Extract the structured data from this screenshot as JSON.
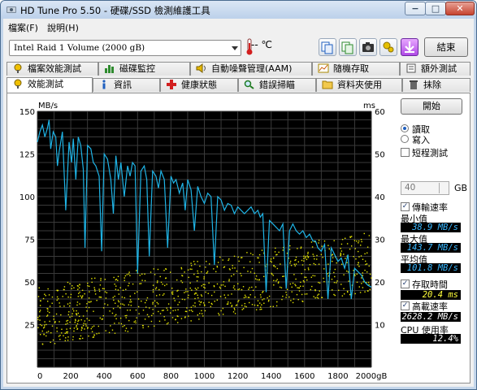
{
  "window": {
    "title": "HD Tune Pro 5.50 - 硬碟/SSD 檢測維護工具",
    "min_symbol": "−",
    "max_symbol": "□",
    "close_symbol": "✕"
  },
  "menu": {
    "file": "檔案(F)",
    "help": "說明(H)"
  },
  "toolbar": {
    "drive": "Intel  Raid 1 Volume (2000 gB)",
    "temperature": "-- ℃",
    "exit_label": "結束",
    "icons": [
      "copy-info-icon",
      "copy-screen-icon",
      "camera-icon",
      "settings-icon",
      "download-icon"
    ]
  },
  "tabs_row1": [
    "檔案效能測試",
    "磁碟監控",
    "自動噪聲管理(AAM)",
    "隨機存取",
    "額外測試"
  ],
  "tabs_row2": [
    "效能測試",
    "資訊",
    "健康狀態",
    "錯誤掃瞄",
    "資料夾使用",
    "抹除"
  ],
  "right_panel": {
    "start_label": "開始",
    "read_label": "讀取",
    "write_label": "寫入",
    "short_test_label": "短程測試",
    "short_test_value": "40",
    "short_test_unit": "GB",
    "transfer_rate_label": "傳輸速率",
    "min_label": "最小值",
    "min_value": "38.9 MB/s",
    "max_label": "最大值",
    "max_value": "143.7 MB/s",
    "avg_label": "平均值",
    "avg_value": "101.8 MB/s",
    "access_time_label": "存取時間",
    "access_time_value": "20.4 ms",
    "burst_rate_label": "高載速率",
    "burst_rate_value": "2628.2 MB/s",
    "cpu_label": "CPU 使用率",
    "cpu_value": "12.4%",
    "read_selected": true,
    "short_test_checked": false,
    "transfer_checked": true,
    "access_checked": true,
    "burst_checked": true
  },
  "colors": {
    "transfer": "#1fb4e6",
    "access": "#e6e600",
    "value_cyan": "#3ab8ff",
    "value_yellow": "#ffff3c",
    "value_white": "#ffffff"
  },
  "chart_data": {
    "type": "line",
    "x_unit": "gB",
    "y_left_unit": "MB/s",
    "y_right_unit": "ms",
    "xlim": [
      0,
      2000
    ],
    "ylim_left": [
      0,
      150
    ],
    "ylim_right": [
      0,
      60
    ],
    "x_ticks": [
      "0",
      "200",
      "400",
      "600",
      "800",
      "1000",
      "1200",
      "1400",
      "1600",
      "1800",
      "2000gB"
    ],
    "y_left_ticks": [
      "25",
      "50",
      "75",
      "100",
      "125",
      "150"
    ],
    "y_right_ticks": [
      "10",
      "20",
      "30",
      "40",
      "50",
      "60"
    ],
    "grid": true,
    "series": [
      {
        "name": "transfer rate",
        "axis": "left",
        "x": [
          0,
          15,
          30,
          45,
          60,
          70,
          80,
          95,
          110,
          120,
          130,
          150,
          170,
          190,
          205,
          215,
          230,
          245,
          260,
          275,
          285,
          300,
          320,
          335,
          350,
          370,
          385,
          400,
          420,
          440,
          455,
          470,
          485,
          500,
          520,
          540,
          555,
          570,
          585,
          600,
          620,
          640,
          655,
          670,
          690,
          710,
          725,
          740,
          760,
          780,
          800,
          815,
          830,
          850,
          870,
          885,
          900,
          920,
          940,
          960,
          980,
          1000,
          1020,
          1040,
          1060,
          1080,
          1100,
          1120,
          1140,
          1160,
          1180,
          1200,
          1220,
          1240,
          1260,
          1280,
          1300,
          1320,
          1335,
          1350,
          1370,
          1390,
          1410,
          1430,
          1450,
          1470,
          1490,
          1510,
          1530,
          1550,
          1570,
          1590,
          1610,
          1630,
          1650,
          1665,
          1680,
          1700,
          1720,
          1740,
          1760,
          1780,
          1800,
          1820,
          1840,
          1860,
          1880,
          1900,
          1920,
          1940,
          1960,
          1980,
          2000
        ],
        "y": [
          132,
          138,
          142,
          135,
          140,
          145,
          128,
          138,
          135,
          118,
          126,
          138,
          92,
          132,
          120,
          134,
          110,
          135,
          130,
          116,
          70,
          130,
          128,
          120,
          118,
          112,
          68,
          125,
          122,
          110,
          90,
          124,
          110,
          120,
          100,
          118,
          112,
          120,
          118,
          55,
          115,
          118,
          110,
          65,
          115,
          112,
          105,
          115,
          110,
          70,
          112,
          108,
          110,
          102,
          108,
          92,
          110,
          104,
          80,
          106,
          100,
          96,
          102,
          100,
          60,
          100,
          98,
          92,
          96,
          95,
          90,
          94,
          92,
          90,
          92,
          94,
          90,
          92,
          88,
          90,
          44,
          86,
          84,
          82,
          80,
          84,
          46,
          80,
          84,
          80,
          78,
          80,
          76,
          78,
          74,
          74,
          70,
          68,
          72,
          40,
          70,
          66,
          62,
          64,
          58,
          66,
          40,
          58,
          56,
          54,
          50,
          48,
          47
        ]
      },
      {
        "name": "access time",
        "axis": "right",
        "points": "scatter",
        "trend_start": 12,
        "trend_end": 25
      }
    ]
  }
}
